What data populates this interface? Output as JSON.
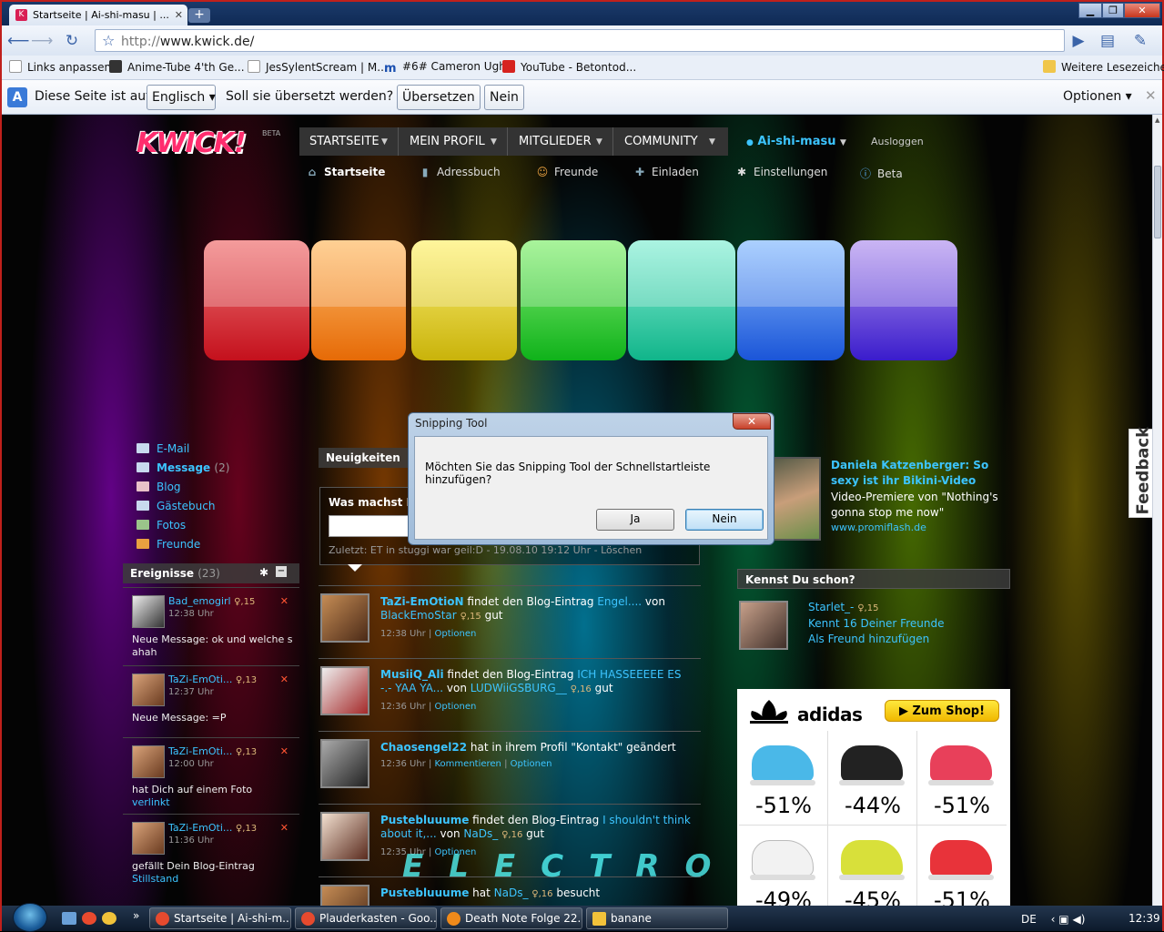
{
  "browser": {
    "tab_title": "Startseite | Ai-shi-masu | ...",
    "url_protocol": "http://",
    "url_host": "www.kwick.de/"
  },
  "bookmarks": [
    {
      "label": "Links anpassen",
      "icon": "document-icon"
    },
    {
      "label": "Anime-Tube 4'th Ge...",
      "icon": "cat-icon"
    },
    {
      "label": "JesSylentScream | M...",
      "icon": "document-icon"
    },
    {
      "label": "#6# Cameron Ugh",
      "icon": "m-icon"
    },
    {
      "label": "YouTube - Betontod...",
      "icon": "youtube-icon"
    },
    {
      "label": "Weitere Lesezeichen",
      "icon": "folder-icon"
    }
  ],
  "translate_bar": {
    "prefix": "Diese Seite ist auf",
    "language": "Englisch",
    "question": "Soll sie übersetzt werden?",
    "translate_button": "Übersetzen",
    "no_button": "Nein",
    "options": "Optionen"
  },
  "site": {
    "logo": "KWICK!",
    "beta_label": "BETA",
    "nav": [
      "STARTSEITE",
      "MEIN PROFIL",
      "MITGLIEDER",
      "COMMUNITY"
    ],
    "username": "Ai-shi-masu",
    "logout": "Ausloggen",
    "subnav": [
      {
        "label": "Startseite",
        "icon": "home-icon"
      },
      {
        "label": "Adressbuch",
        "icon": "addressbook-icon"
      },
      {
        "label": "Freunde",
        "icon": "friends-icon"
      },
      {
        "label": "Einladen",
        "icon": "plus-icon"
      },
      {
        "label": "Einstellungen",
        "icon": "gear-icon"
      },
      {
        "label": "Beta",
        "icon": "info-icon"
      }
    ],
    "banner_text": "ELECTRO",
    "banner_colors": [
      "#e8202a",
      "#f07a10",
      "#e6d11a",
      "#1fd12a",
      "#1fd9a8",
      "#2c6ff0",
      "#7a4fe0"
    ]
  },
  "left": {
    "links": [
      {
        "label": "E-Mail"
      },
      {
        "label": "Message",
        "count": "(2)"
      },
      {
        "label": "Blog"
      },
      {
        "label": "Gästebuch"
      },
      {
        "label": "Fotos"
      },
      {
        "label": "Freunde"
      }
    ],
    "events_title": "Ereignisse",
    "events_count": "(23)",
    "events": [
      {
        "name": "Bad_emogirl",
        "age": "♀,15",
        "time": "12:38 Uhr",
        "message": "Neue Message: ok und welche s ahah",
        "link": ""
      },
      {
        "name": "TaZi-EmOti...",
        "age": "♀,13",
        "time": "12:37 Uhr",
        "message": "Neue Message: =P",
        "link": ""
      },
      {
        "name": "TaZi-EmOti...",
        "age": "♀,13",
        "time": "12:00 Uhr",
        "message": "hat Dich auf einem Foto",
        "link": "verlinkt"
      },
      {
        "name": "TaZi-EmOti...",
        "age": "♀,13",
        "time": "11:36 Uhr",
        "message": "gefällt Dein Blog-Eintrag",
        "link": "Stillstand"
      }
    ],
    "delete_symbol": "✕"
  },
  "center": {
    "news_title": "Neuigkeiten",
    "status_prompt": "Was machst Du gerade?",
    "last_status": "Zuletzt: ET in stuggi war geil:D - 19.08.10 19:12 Uhr - Löschen",
    "feed": [
      {
        "user": "TaZi-EmOtioN",
        "mid": " findet den Blog-Eintrag ",
        "link": "Engel....",
        "by": " von ",
        "author": "BlackEmoStar",
        "age": "♀,15",
        "tail": " gut",
        "time": "12:38 Uhr",
        "actions": [
          "Optionen"
        ]
      },
      {
        "user": "MusiiQ_Ali",
        "mid": " findet den Blog-Eintrag ",
        "link": "ICH HASSEEEEE ES -.- YAA YA...",
        "by": " von ",
        "author": "LUDWiiGSBURG__",
        "age": "♀,16",
        "tail": " gut",
        "time": "12:36 Uhr",
        "actions": [
          "Optionen"
        ]
      },
      {
        "user": "Chaosengel22",
        "mid": " hat in ihrem Profil \"Kontakt\" geändert",
        "link": "",
        "by": "",
        "author": "",
        "age": "",
        "tail": "",
        "time": "12:36 Uhr",
        "actions": [
          "Kommentieren",
          "Optionen"
        ]
      },
      {
        "user": "Pustebluuume",
        "mid": " findet den Blog-Eintrag ",
        "link": "I shouldn't think about it,...",
        "by": " von ",
        "author": "NaDs_",
        "age": "♀,16",
        "tail": " gut",
        "time": "12:35 Uhr",
        "actions": [
          "Optionen"
        ]
      },
      {
        "user": "Pustebluuume",
        "mid": " hat ",
        "link": "",
        "by": "",
        "author": "NaDs_",
        "age": "♀,16",
        "tail": " besucht",
        "time": "",
        "actions": []
      }
    ]
  },
  "right": {
    "promo_title": "Daniela Katzenberger: So sexy ist ihr Bikini-Video",
    "promo_text": "Video-Premiere von \"Nothing's gonna stop me now\"",
    "promo_url": "www.promiflash.de",
    "knows_title": "Kennst Du schon?",
    "knows_name": "Starlet_-",
    "knows_age": "♀,15",
    "knows_mutual": "Kennt 16 Deiner Freunde",
    "knows_add": "Als Freund hinzufügen",
    "ad_brand": "adidas",
    "ad_button": "Zum Shop!",
    "ad_items": [
      {
        "discount": "-51%",
        "color": "#4ab8e8"
      },
      {
        "discount": "-44%",
        "color": "#222222"
      },
      {
        "discount": "-51%",
        "color": "#e8405a"
      },
      {
        "discount": "-49%",
        "color": "#f2f2f2"
      },
      {
        "discount": "-45%",
        "color": "#d8e03a"
      },
      {
        "discount": "-51%",
        "color": "#e8333a"
      }
    ],
    "feedback_label": "Feedback"
  },
  "dialog": {
    "title": "Snipping Tool",
    "message": "Möchten Sie das Snipping Tool der Schnellstartleiste hinzufügen?",
    "yes": "Ja",
    "no": "Nein"
  },
  "taskbar": {
    "tasks": [
      {
        "label": "Startseite | Ai-shi-m...",
        "color": "#e64a2e"
      },
      {
        "label": "Plauderkasten - Goo...",
        "color": "#e64a2e"
      },
      {
        "label": "Death Note Folge 22...",
        "color": "#f08a1a"
      },
      {
        "label": "banane",
        "color": "#f2c23a"
      }
    ],
    "lang": "DE",
    "time": "12:39"
  }
}
